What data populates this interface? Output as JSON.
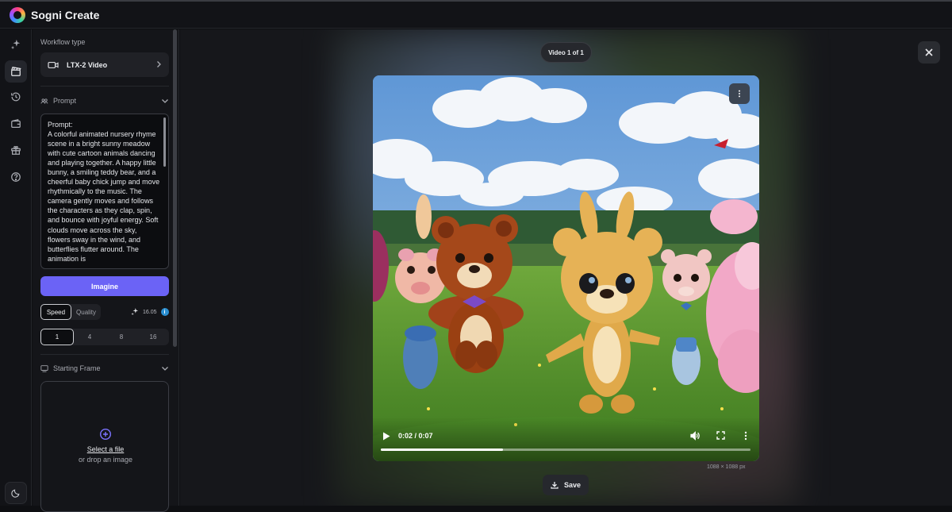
{
  "app": {
    "title": "Sogni Create"
  },
  "rail": {
    "items": [
      {
        "icon": "sparkles-icon",
        "active": false
      },
      {
        "icon": "clapperboard-icon",
        "active": true
      },
      {
        "icon": "history-icon",
        "active": false
      },
      {
        "icon": "wallet-icon",
        "active": false
      },
      {
        "icon": "gift-icon",
        "active": false
      },
      {
        "icon": "help-icon",
        "active": false
      }
    ],
    "bottom_icon": "moon-icon"
  },
  "panel": {
    "workflow_label": "Workflow type",
    "workflow_value": "LTX-2 Video",
    "prompt_section_label": "Prompt",
    "prompt_text": "Prompt:\nA colorful animated nursery rhyme scene in a bright sunny meadow with cute cartoon animals dancing and playing together. A happy little bunny, a smiling teddy bear, and a cheerful baby chick jump and move rhythmically to the music. The camera gently moves and follows the characters as they clap, spin, and bounce with joyful energy. Soft clouds move across the sky, flowers sway in the wind, and butterflies flutter around. The animation is",
    "imagine_label": "Imagine",
    "mode_options": [
      "Speed",
      "Quality"
    ],
    "mode_selected": "Speed",
    "credits_value": "16.05",
    "credits_info": "i",
    "count_options": [
      "1",
      "4",
      "8",
      "16"
    ],
    "count_selected": "1",
    "starting_frame_label": "Starting Frame",
    "drop_link": "Select a file",
    "drop_sub": "or drop an image"
  },
  "viewer": {
    "counter": "Video 1 of 1",
    "time": "0:02 / 0:07",
    "progress": 0.33,
    "dimensions": "1088 × 1088 px",
    "save_label": "Save"
  },
  "colors": {
    "accent": "#6b63f6",
    "info": "#2b8fd1"
  }
}
